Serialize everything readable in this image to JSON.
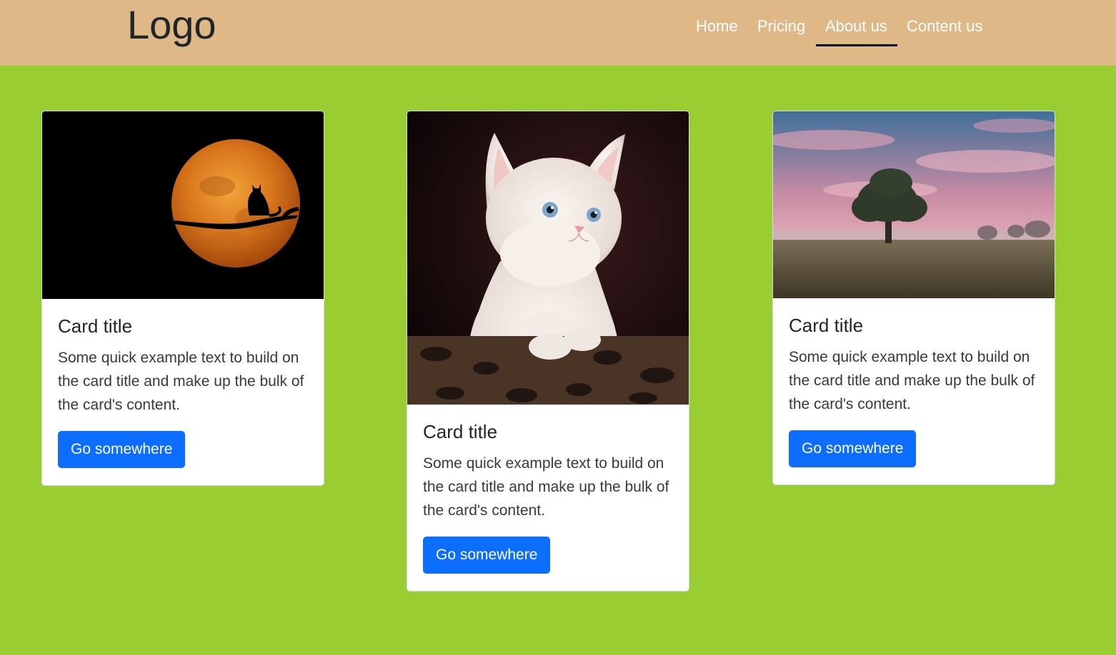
{
  "header": {
    "logo": "Logo",
    "nav": [
      {
        "label": "Home"
      },
      {
        "label": "Pricing"
      },
      {
        "label": "About us",
        "active": true
      },
      {
        "label": "Content us"
      }
    ]
  },
  "cards": [
    {
      "image": "moon-cat-silhouette",
      "title": "Card title",
      "text": "Some quick example text to build on the card title and make up the bulk of the card's content.",
      "button": "Go somewhere"
    },
    {
      "image": "white-kitten",
      "title": "Card title",
      "text": "Some quick example text to build on the card title and make up the bulk of the card's content.",
      "button": "Go somewhere"
    },
    {
      "image": "tree-sunset-field",
      "title": "Card title",
      "text": "Some quick example text to build on the card title and make up the bulk of the card's content.",
      "button": "Go somewhere"
    }
  ],
  "colors": {
    "header_bg": "#deb887",
    "page_bg": "#9acd32",
    "button_bg": "#0d6efd"
  }
}
